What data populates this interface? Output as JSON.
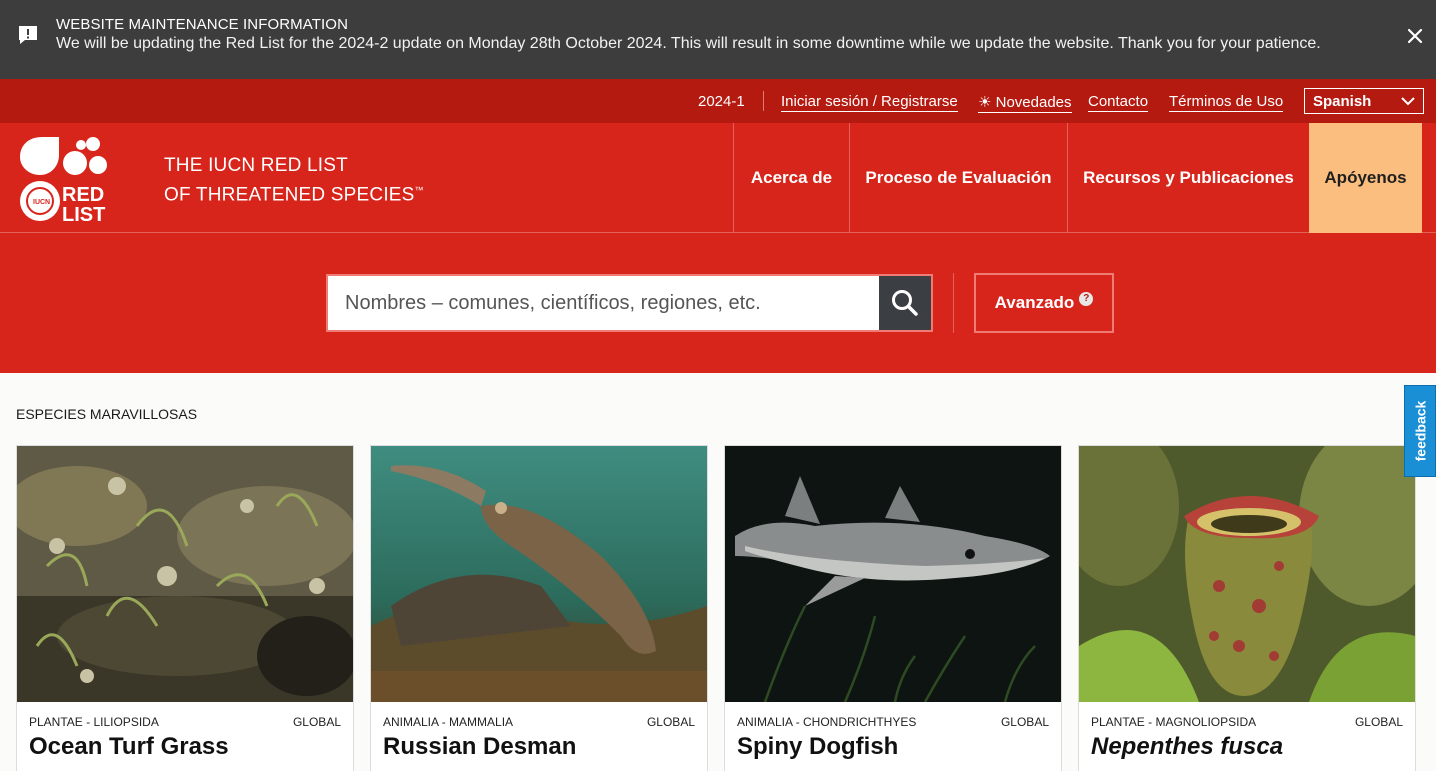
{
  "banner": {
    "title": "WEBSITE MAINTENANCE INFORMATION",
    "message": "We will be updating the Red List for the 2024-2 update on Monday 28th October 2024. This will result in some downtime while we update the website. Thank you for your patience.",
    "icon": "alert-icon",
    "close_icon": "close-icon"
  },
  "utility": {
    "version": "2024-1",
    "login": "Iniciar sesión / Registrarse",
    "news": "☀ Novedades",
    "contact": "Contacto",
    "terms": "Términos de Uso",
    "language": "Spanish"
  },
  "header": {
    "logo_text_1": "RED",
    "logo_text_2": "LIST",
    "brand_line1": "THE IUCN RED LIST",
    "brand_line2": "OF THREATENED SPECIES",
    "brand_tm": "™",
    "nav": [
      "Acerca de",
      "Proceso de Evaluación",
      "Recursos y Publicaciones",
      "Apóyenos"
    ]
  },
  "search": {
    "placeholder": "Nombres – comunes, científicos, regiones, etc.",
    "advanced_label": "Avanzado",
    "help_glyph": "?"
  },
  "section": {
    "title": "ESPECIES MARAVILLOSAS"
  },
  "cards": [
    {
      "taxonomy": "PLANTAE - LILIOPSIDA",
      "scope": "GLOBAL",
      "name": "Ocean Turf Grass"
    },
    {
      "taxonomy": "ANIMALIA - MAMMALIA",
      "scope": "GLOBAL",
      "name": "Russian Desman"
    },
    {
      "taxonomy": "ANIMALIA - CHONDRICHTHYES",
      "scope": "GLOBAL",
      "name": "Spiny Dogfish"
    },
    {
      "taxonomy": "PLANTAE - MAGNOLIOPSIDA",
      "scope": "GLOBAL",
      "name": "Nepenthes fusca"
    }
  ],
  "feedback": {
    "label": "feedback"
  },
  "colors": {
    "brand_red": "#d8251c",
    "dark_red": "#b41a10",
    "support_orange": "#fbbe7e",
    "banner_gray": "#3d3d3d",
    "feedback_blue": "#1a8fd6"
  }
}
